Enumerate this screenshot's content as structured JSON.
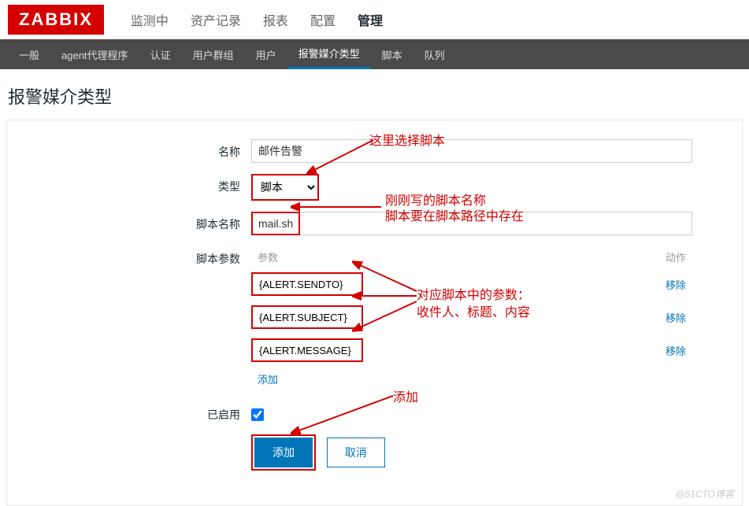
{
  "logo": "ZABBIX",
  "topnav": {
    "items": [
      "监测中",
      "资产记录",
      "报表",
      "配置",
      "管理"
    ],
    "activeIndex": 4
  },
  "subnav": {
    "items": [
      "一般",
      "agent代理程序",
      "认证",
      "用户群组",
      "用户",
      "报警媒介类型",
      "脚本",
      "队列"
    ],
    "activeIndex": 5
  },
  "pageTitle": "报警媒介类型",
  "form": {
    "nameLabel": "名称",
    "nameValue": "邮件告警",
    "typeLabel": "类型",
    "typeValue": "脚本",
    "scriptNameLabel": "脚本名称",
    "scriptNameValue": "mail.sh",
    "scriptParamsLabel": "脚本参数",
    "paramsHeader": "参数",
    "actionHeader": "动作",
    "params": [
      {
        "value": "{ALERT.SENDTO}",
        "remove": "移除"
      },
      {
        "value": "{ALERT.SUBJECT}",
        "remove": "移除"
      },
      {
        "value": "{ALERT.MESSAGE}",
        "remove": "移除"
      }
    ],
    "addParamLink": "添加",
    "enabledLabel": "已启用",
    "submitButton": "添加",
    "cancelButton": "取消"
  },
  "annotations": {
    "a1": "这里选择脚本",
    "a2_line1": "刚刚写的脚本名称",
    "a2_line2": "脚本要在脚本路径中存在",
    "a3_line1": "对应脚本中的参数：",
    "a3_line2": "收件人、标题、内容",
    "a4": "添加"
  },
  "watermark": "@51CTO博客"
}
